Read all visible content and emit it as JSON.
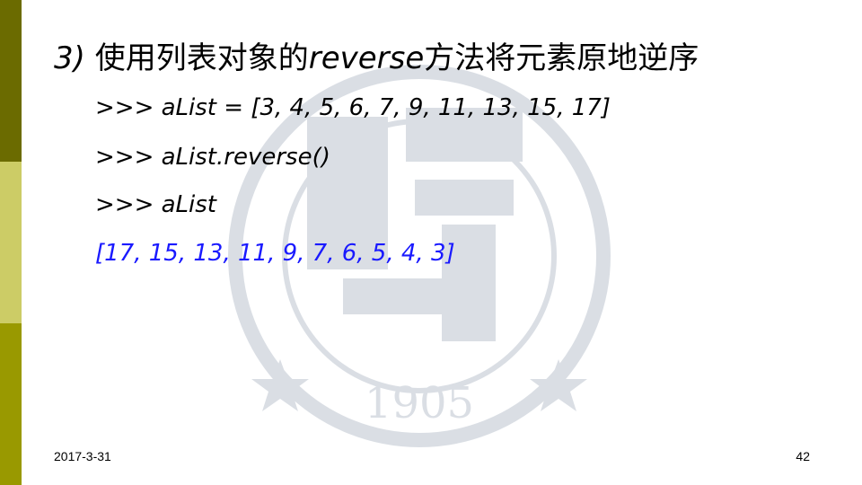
{
  "slide": {
    "title_number": "3)",
    "title_prefix": "使用列表对象的",
    "title_method": "reverse",
    "title_suffix": "方法将元素原地逆序",
    "code_lines": [
      ">>> aList = [3, 4, 5, 6, 7, 9, 11, 13, 15, 17]",
      ">>> aList.reverse()",
      ">>> aList",
      "[17, 15, 13, 11, 9, 7, 6, 5, 4, 3]"
    ],
    "output_color": "#1a1aff"
  },
  "watermark": {
    "year": "1905"
  },
  "footer": {
    "date": "2017-3-31",
    "page_number": "42"
  },
  "colors": {
    "sidebar_top": "#6b6b00",
    "sidebar_middle": "#cccc66",
    "sidebar_bottom": "#999900"
  }
}
